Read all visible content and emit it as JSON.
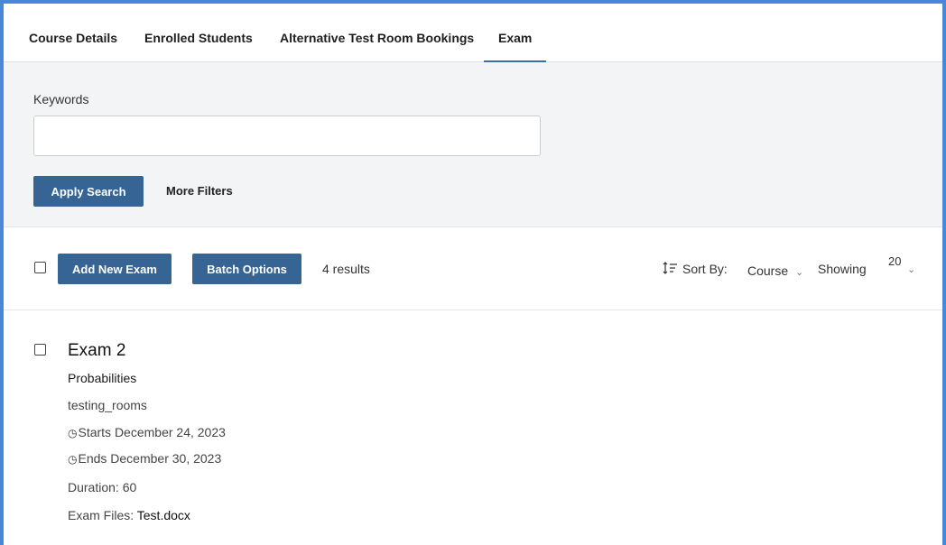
{
  "tabs": [
    {
      "label": "Course Details"
    },
    {
      "label": "Enrolled Students"
    },
    {
      "label": "Alternative Test Room Bookings"
    },
    {
      "label": "Exam"
    }
  ],
  "search": {
    "keywords_label": "Keywords",
    "keywords_value": "",
    "keywords_placeholder": "",
    "apply_label": "Apply Search",
    "more_filters_label": "More Filters"
  },
  "toolbar": {
    "add_label": "Add New Exam",
    "batch_label": "Batch Options",
    "results_text": "4 results",
    "sort_icon": "sort-icon",
    "sort_label": "Sort By:",
    "sort_value": "Course",
    "showing_label": "Showing",
    "page_size": "20"
  },
  "exams": [
    {
      "title": "Exam 2",
      "course": "Probabilities",
      "room": "testing_rooms",
      "starts": "Starts December 24, 2023",
      "ends": "Ends December 30, 2023",
      "duration": "Duration: 60",
      "files_label": "Exam Files:",
      "file_name": "Test.docx"
    }
  ],
  "colors": {
    "accent": "#356495",
    "frame": "#4a86d9",
    "panel_bg": "#f3f4f5"
  }
}
